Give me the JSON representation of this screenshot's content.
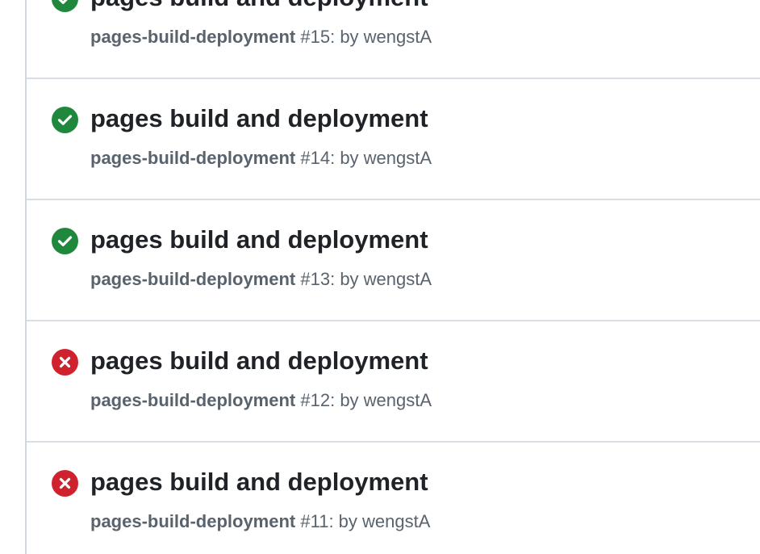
{
  "runs": [
    {
      "status": "success",
      "status_icon": "check-circle-icon",
      "title": "pages build and deployment",
      "workflow": "pages-build-deployment",
      "number": "#15",
      "by": ": by wengstA"
    },
    {
      "status": "success",
      "status_icon": "check-circle-icon",
      "title": "pages build and deployment",
      "workflow": "pages-build-deployment",
      "number": "#14",
      "by": ": by wengstA"
    },
    {
      "status": "success",
      "status_icon": "check-circle-icon",
      "title": "pages build and deployment",
      "workflow": "pages-build-deployment",
      "number": "#13",
      "by": ": by wengstA"
    },
    {
      "status": "failure",
      "status_icon": "x-circle-icon",
      "title": "pages build and deployment",
      "workflow": "pages-build-deployment",
      "number": "#12",
      "by": ": by wengstA"
    },
    {
      "status": "failure",
      "status_icon": "x-circle-icon",
      "title": "pages build and deployment",
      "workflow": "pages-build-deployment",
      "number": "#11",
      "by": ": by wengstA"
    }
  ],
  "colors": {
    "success": "#1f883d",
    "failure": "#cf222e",
    "title": "#1f2328",
    "meta": "#59636e",
    "divider": "#d8dee4"
  }
}
